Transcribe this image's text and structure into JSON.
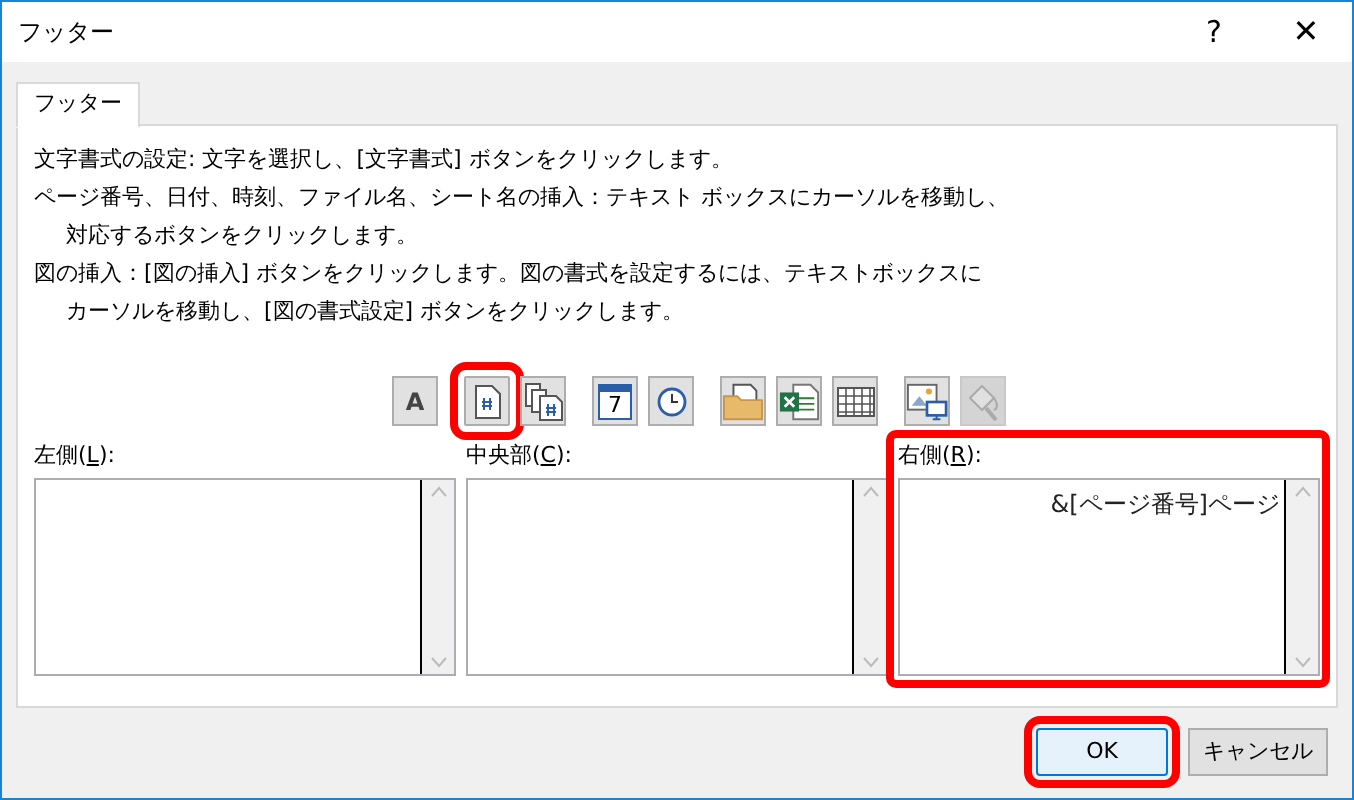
{
  "window": {
    "title": "フッター",
    "help": "?",
    "close": "✕"
  },
  "tabs": [
    {
      "label": "フッター",
      "selected": true
    }
  ],
  "instructions": [
    [
      "文字書式の設定: 文字を選択し、[文字書式] ボタンをクリックします。"
    ],
    [
      "ページ番号、日付、時刻、ファイル名、シート名の挿入：テキスト ボックスにカーソルを移動し、",
      "対応するボタンをクリックします。"
    ],
    [
      "図の挿入：[図の挿入] ボタンをクリックします。図の書式を設定するには、テキストボックスに",
      "カーソルを移動し、[図の書式設定] ボタンをクリックします。"
    ]
  ],
  "toolbar": [
    [
      {
        "kind": "font",
        "label": "A",
        "highlighted": false,
        "disabled": false
      }
    ],
    [
      {
        "kind": "page-number",
        "highlighted": true,
        "disabled": false
      },
      {
        "kind": "page-count",
        "highlighted": false,
        "disabled": false
      }
    ],
    [
      {
        "kind": "date",
        "label": "7",
        "highlighted": false,
        "disabled": false
      },
      {
        "kind": "time",
        "highlighted": false,
        "disabled": false
      }
    ],
    [
      {
        "kind": "file-path",
        "highlighted": false,
        "disabled": false
      },
      {
        "kind": "file-name",
        "highlighted": false,
        "disabled": false
      },
      {
        "kind": "sheet-name",
        "highlighted": false,
        "disabled": false
      }
    ],
    [
      {
        "kind": "picture",
        "highlighted": false,
        "disabled": false
      },
      {
        "kind": "format-picture",
        "highlighted": false,
        "disabled": true
      }
    ]
  ],
  "sections": [
    {
      "label_before": "左側(",
      "access_key": "L",
      "label_after": "):",
      "highlighted": false
    },
    {
      "label_before": "中央部(",
      "access_key": "C",
      "label_after": "):",
      "highlighted": false
    },
    {
      "label_before": "右側(",
      "access_key": "R",
      "label_after": "):",
      "value": "&[ページ番号]ページ",
      "highlighted": true
    }
  ],
  "buttons": [
    {
      "label": "OK",
      "default": true,
      "highlighted": true
    },
    {
      "label": "キャンセル",
      "default": false,
      "highlighted": false
    }
  ]
}
